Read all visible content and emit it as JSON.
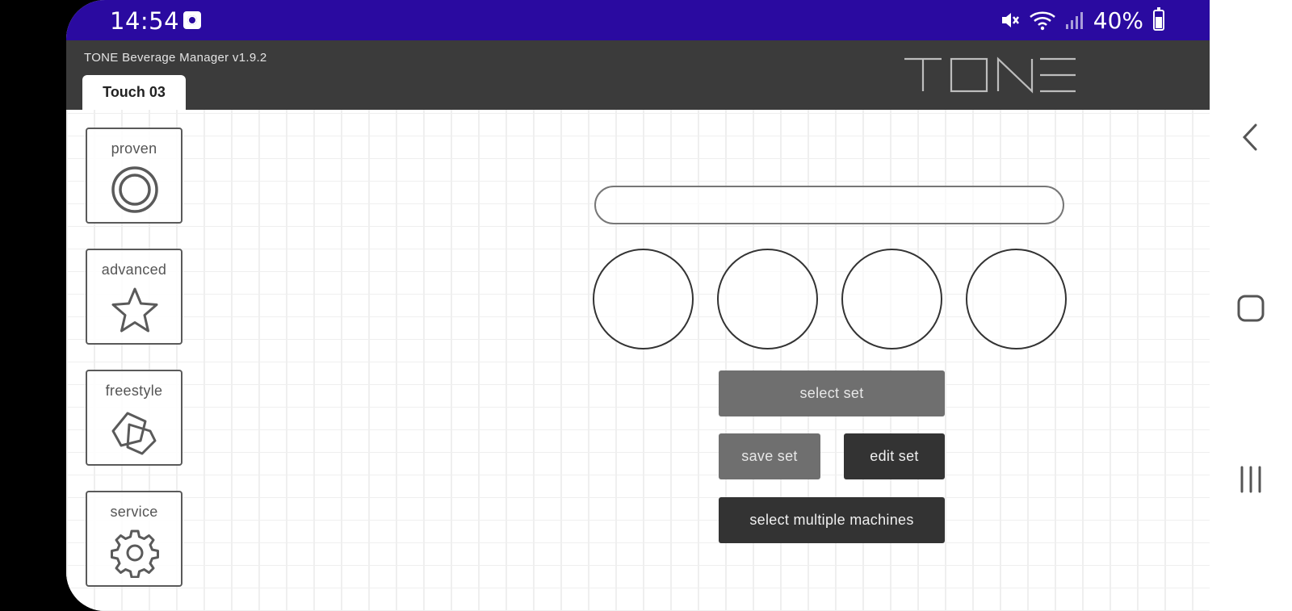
{
  "status_bar": {
    "time": "14:54",
    "battery": "40%",
    "icons": [
      "clock-widget-icon",
      "mute-icon",
      "wifi-icon",
      "signal-icon",
      "battery-icon"
    ]
  },
  "app": {
    "title": "TONE Beverage Manager v1.9.2",
    "brand": "TONE",
    "active_tab": "Touch 03"
  },
  "sidebar": {
    "items": [
      {
        "label": "proven",
        "icon": "double-circle-icon"
      },
      {
        "label": "advanced",
        "icon": "star-icon"
      },
      {
        "label": "freestyle",
        "icon": "overlapping-polygons-icon"
      },
      {
        "label": "service",
        "icon": "gear-icon"
      }
    ]
  },
  "main": {
    "name_field_value": "",
    "slots": 4,
    "buttons": {
      "select_set": "select set",
      "save_set": "save set",
      "edit_set": "edit set",
      "select_multiple": "select multiple machines"
    }
  },
  "colors": {
    "status_bar": "#2a0aa0",
    "app_bar": "#3b3b3b",
    "button_light": "#6f6f6f",
    "button_dark": "#333333"
  }
}
